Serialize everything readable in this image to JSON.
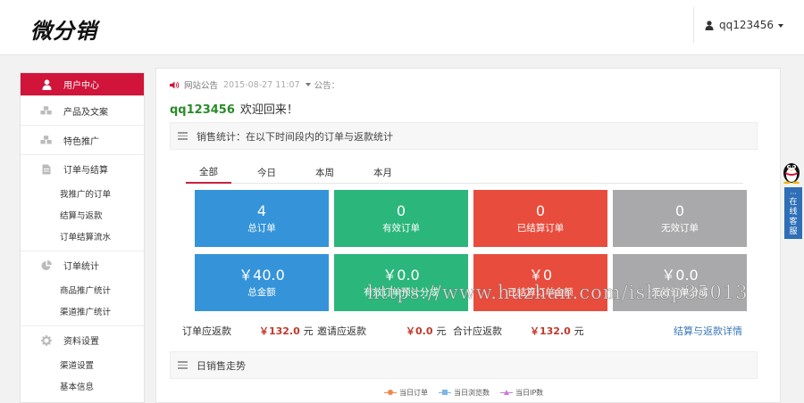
{
  "header": {
    "logo_text": "微分销",
    "username": "qq123456"
  },
  "sidebar": {
    "items": [
      {
        "label": "用户中心",
        "icon": "user-icon",
        "active": true
      },
      {
        "label": "产品及文案",
        "icon": "cubes-icon"
      },
      {
        "label": "特色推广",
        "icon": "cubes-icon"
      }
    ],
    "groups": [
      {
        "label": "订单与结算",
        "icon": "file-icon",
        "children": [
          "我推广的订单",
          "结算与返款",
          "订单结算流水"
        ]
      },
      {
        "label": "订单统计",
        "icon": "pie-chart-icon",
        "children": [
          "商品推广统计",
          "渠道推广统计"
        ]
      },
      {
        "label": "资料设置",
        "icon": "gear-icon",
        "children": [
          "渠道设置",
          "基本信息"
        ]
      }
    ]
  },
  "notice": {
    "label": "网站公告",
    "date": "2015-08-27 11:07",
    "suffix": "公告："
  },
  "welcome": {
    "username": "qq123456",
    "text": "欢迎回来！"
  },
  "sales_panel": {
    "title": "销售统计：在以下时间段内的订单与返款统计",
    "tabs": [
      "全部",
      "今日",
      "本周",
      "本月"
    ],
    "active_tab": 0,
    "tiles": [
      {
        "value": "4",
        "label": "总订单",
        "color": "#3594d9"
      },
      {
        "value": "0",
        "label": "有效订单",
        "color": "#2bb67b"
      },
      {
        "value": "0",
        "label": "已结算订单",
        "color": "#e84c3d"
      },
      {
        "value": "0",
        "label": "无效订单",
        "color": "#a9a9ab"
      },
      {
        "value": "￥40.0",
        "label": "总金额",
        "color": "#3594d9"
      },
      {
        "value": "￥0.0",
        "label": "有效订单预计分成",
        "color": "#2bb67b"
      },
      {
        "value": "￥0",
        "label": "已结算订单金额",
        "color": "#e84c3d"
      },
      {
        "value": "￥0.0",
        "label": "无效订单分成",
        "color": "#a9a9ab"
      }
    ],
    "summary": {
      "order_refund_label": "订单应返款",
      "order_refund_value": "￥132.0",
      "invite_refund_label": "邀请应返款",
      "invite_refund_value": "￥0.0",
      "total_refund_label": "合计应返款",
      "total_refund_value": "￥132.0",
      "unit": "元",
      "details_link": "结算与返款详情"
    }
  },
  "trend_panel": {
    "title": "日销售走势",
    "legend": [
      {
        "name": "当日订单",
        "color": "#f0884a"
      },
      {
        "name": "当日浏览数",
        "color": "#7ab7e8"
      },
      {
        "name": "当日IP数",
        "color": "#c77bd6"
      }
    ]
  },
  "watermark": "https://www.huzhan.com/ishop35013",
  "qq_service": {
    "label_lines": [
      "在",
      "线",
      "客",
      "服"
    ]
  }
}
